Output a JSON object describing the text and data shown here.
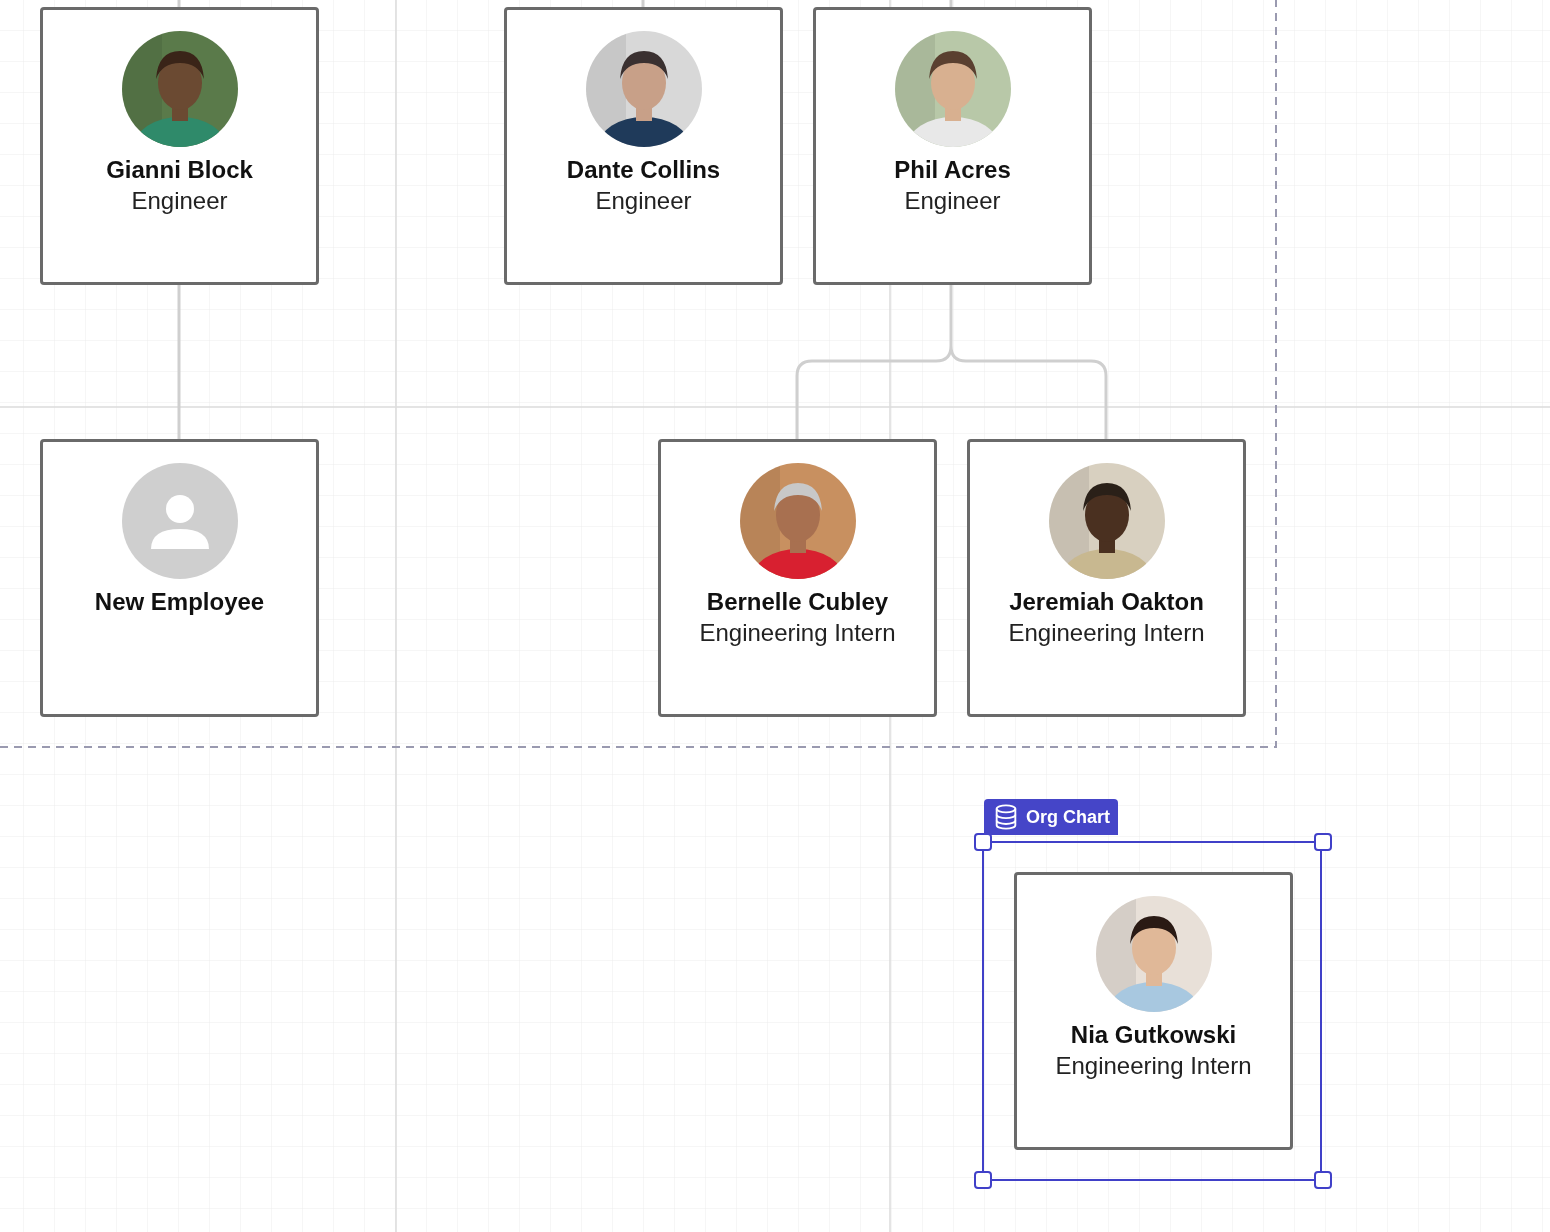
{
  "group": {
    "kind": "dashed"
  },
  "nodes": [
    {
      "name": "Gianni Block",
      "title": "Engineer",
      "selected": false
    },
    {
      "name": "Dante Collins",
      "title": "Engineer",
      "selected": false
    },
    {
      "name": "Phil Acres",
      "title": "Engineer",
      "selected": false
    },
    {
      "name": "New Employee",
      "kind": "placeholder",
      "selected": false
    },
    {
      "name": "Bernelle Cubley",
      "title": "Engineering Intern",
      "selected": false
    },
    {
      "name": "Jeremiah Oakton",
      "title": "Engineering Intern",
      "selected": false
    },
    {
      "name": "Nia Gutkowski",
      "title": "Engineering Intern",
      "selected": true
    }
  ],
  "selection_badge": {
    "label": "Org Chart"
  }
}
